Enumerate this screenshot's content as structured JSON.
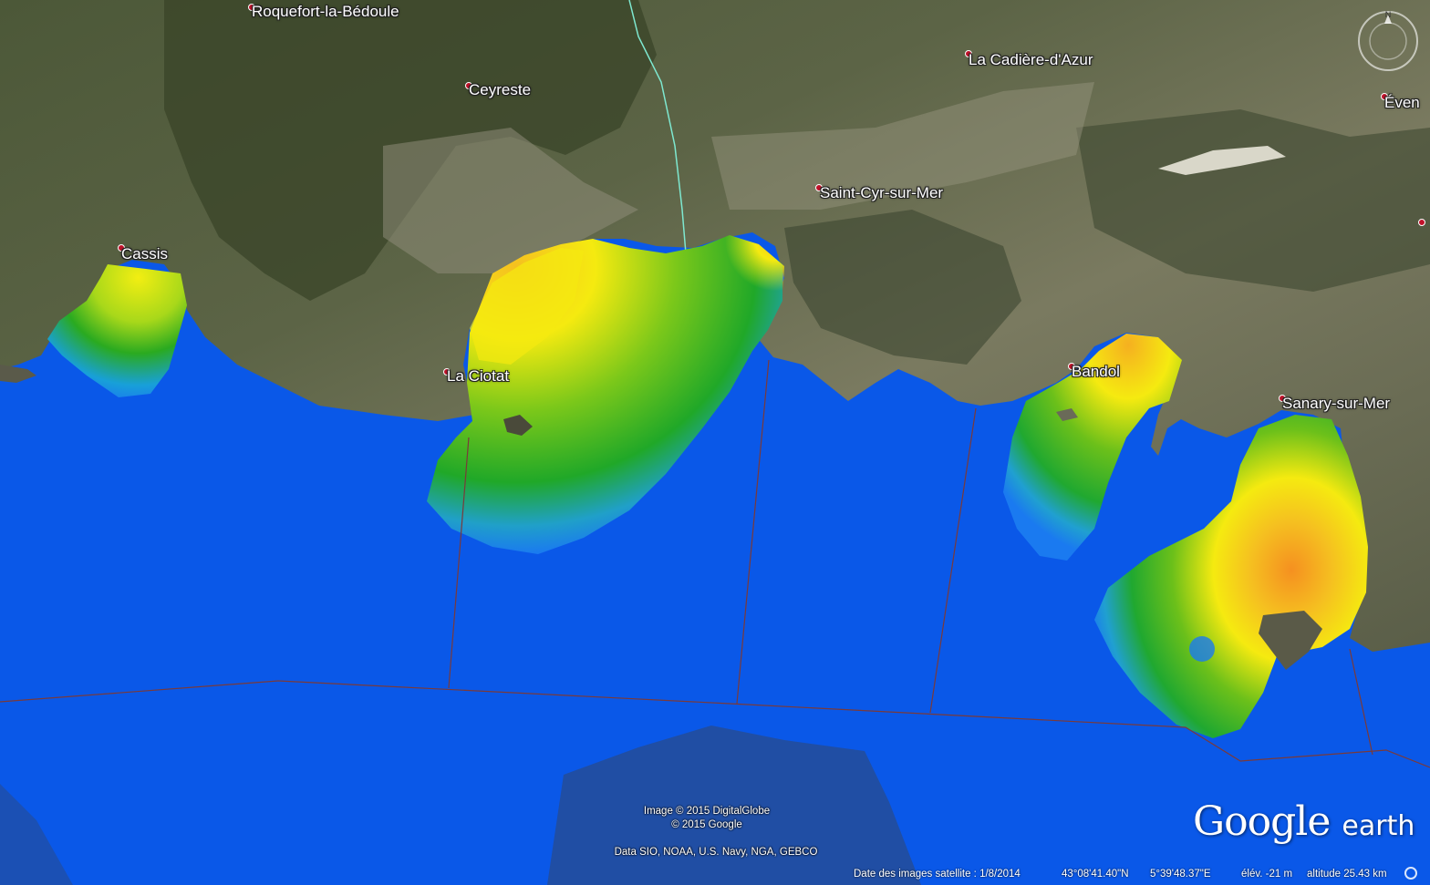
{
  "places": [
    {
      "id": "roquefort",
      "label": "Roquefort-la-Bédoule"
    },
    {
      "id": "ceyreste",
      "label": "Ceyreste"
    },
    {
      "id": "cadiere",
      "label": "La Cadière-d'Azur"
    },
    {
      "id": "saint-cyr",
      "label": "Saint-Cyr-sur-Mer"
    },
    {
      "id": "cassis",
      "label": "Cassis"
    },
    {
      "id": "la-ciotat",
      "label": "La Ciotat"
    },
    {
      "id": "bandol",
      "label": "Bandol"
    },
    {
      "id": "sanary",
      "label": "Sanary-sur-Mer"
    },
    {
      "id": "evenos",
      "label": "Éven"
    }
  ],
  "credits": {
    "imagery_line1": "Image © 2015 DigitalGlobe",
    "imagery_line2": "© 2015 Google",
    "data": "Data SIO, NOAA, U.S. Navy, NGA, GEBCO"
  },
  "status_bar": {
    "image_date": "Date des images satellite : 1/8/2014",
    "latitude": "43°08'41.40\"N",
    "longitude": "5°39'48.37\"E",
    "elevation": "élév.  -21 m",
    "altitude": "altitude  25.43 km"
  },
  "logo": {
    "google": "Google",
    "earth": "earth"
  },
  "colors": {
    "sea": "#0a58e8",
    "land_dark": "#3e4a2c",
    "land_light": "#8a8a6c",
    "scale_high": "#f5a020",
    "scale_mid_high": "#f5ea10",
    "scale_mid": "#22a818",
    "scale_low": "#1a8cf0",
    "boundary": "#7a3a3a"
  },
  "icons": [
    "compass-icon",
    "place-pin-icon",
    "loading-icon"
  ]
}
